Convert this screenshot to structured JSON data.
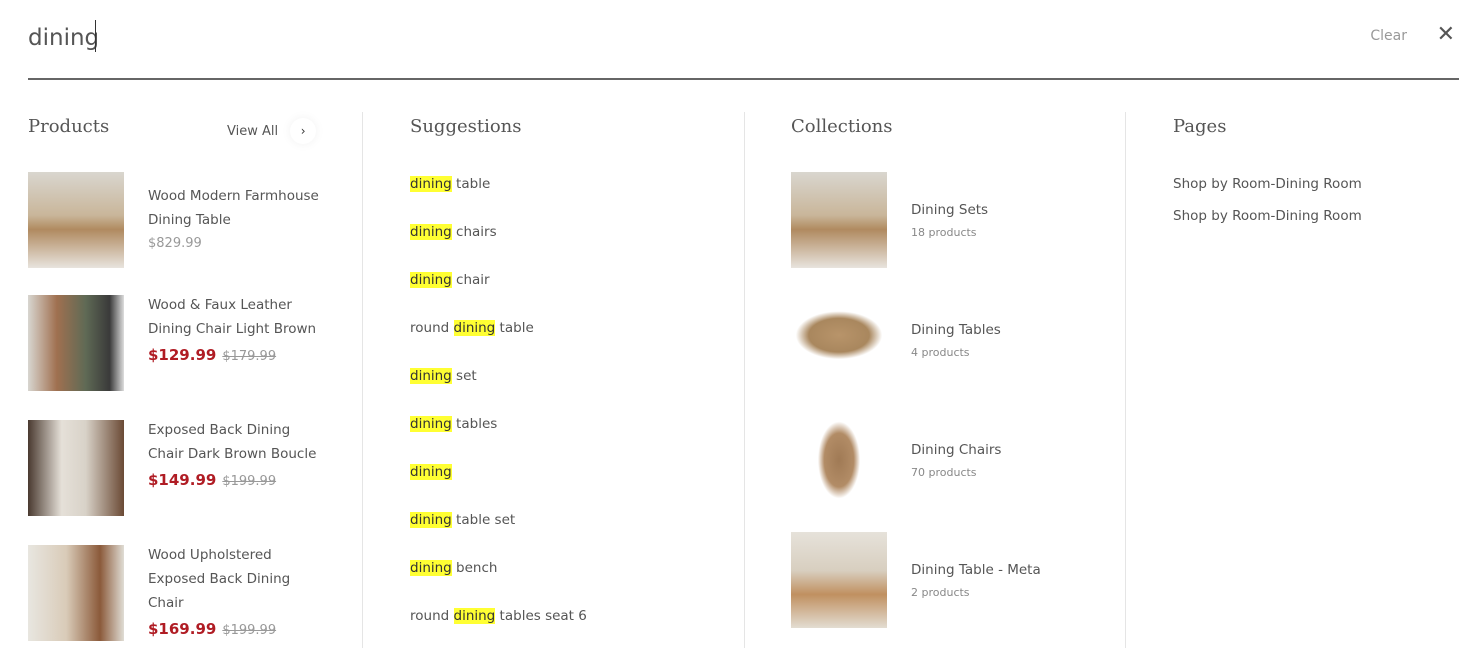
{
  "search": {
    "value": "dining",
    "clear_label": "Clear",
    "close_icon": "close-icon"
  },
  "products": {
    "heading": "Products",
    "view_all": "View All",
    "items": [
      {
        "name": "Wood Modern Farmhouse Dining Table",
        "price": "$829.99"
      },
      {
        "name": "Wood & Faux Leather Dining Chair Light Brown",
        "sale_price": "$129.99",
        "original_price": "$179.99"
      },
      {
        "name": "Exposed Back Dining Chair Dark Brown Boucle",
        "sale_price": "$149.99",
        "original_price": "$199.99"
      },
      {
        "name": "Wood Upholstered Exposed Back Dining Chair",
        "sale_price": "$169.99",
        "original_price": "$199.99"
      }
    ]
  },
  "suggestions": {
    "heading": "Suggestions",
    "items": [
      {
        "before": "",
        "match": "dining",
        "after": " table"
      },
      {
        "before": "",
        "match": "dining",
        "after": " chairs"
      },
      {
        "before": "",
        "match": "dining",
        "after": " chair"
      },
      {
        "before": "round ",
        "match": "dining",
        "after": " table"
      },
      {
        "before": "",
        "match": "dining",
        "after": " set"
      },
      {
        "before": "",
        "match": "dining",
        "after": " tables"
      },
      {
        "before": "",
        "match": "dining",
        "after": ""
      },
      {
        "before": "",
        "match": "dining",
        "after": " table set"
      },
      {
        "before": "",
        "match": "dining",
        "after": " bench"
      },
      {
        "before": "round ",
        "match": "dining",
        "after": " tables seat 6"
      }
    ]
  },
  "collections": {
    "heading": "Collections",
    "items": [
      {
        "name": "Dining Sets",
        "count": "18 products"
      },
      {
        "name": "Dining Tables",
        "count": "4 products"
      },
      {
        "name": "Dining Chairs",
        "count": "70 products"
      },
      {
        "name": "Dining Table - Meta",
        "count": "2 products"
      }
    ]
  },
  "pages": {
    "heading": "Pages",
    "items": [
      "Shop by Room-Dining Room",
      "Shop by Room-Dining Room"
    ]
  },
  "colors": {
    "highlight": "#ffff33",
    "sale": "#b01c24"
  }
}
